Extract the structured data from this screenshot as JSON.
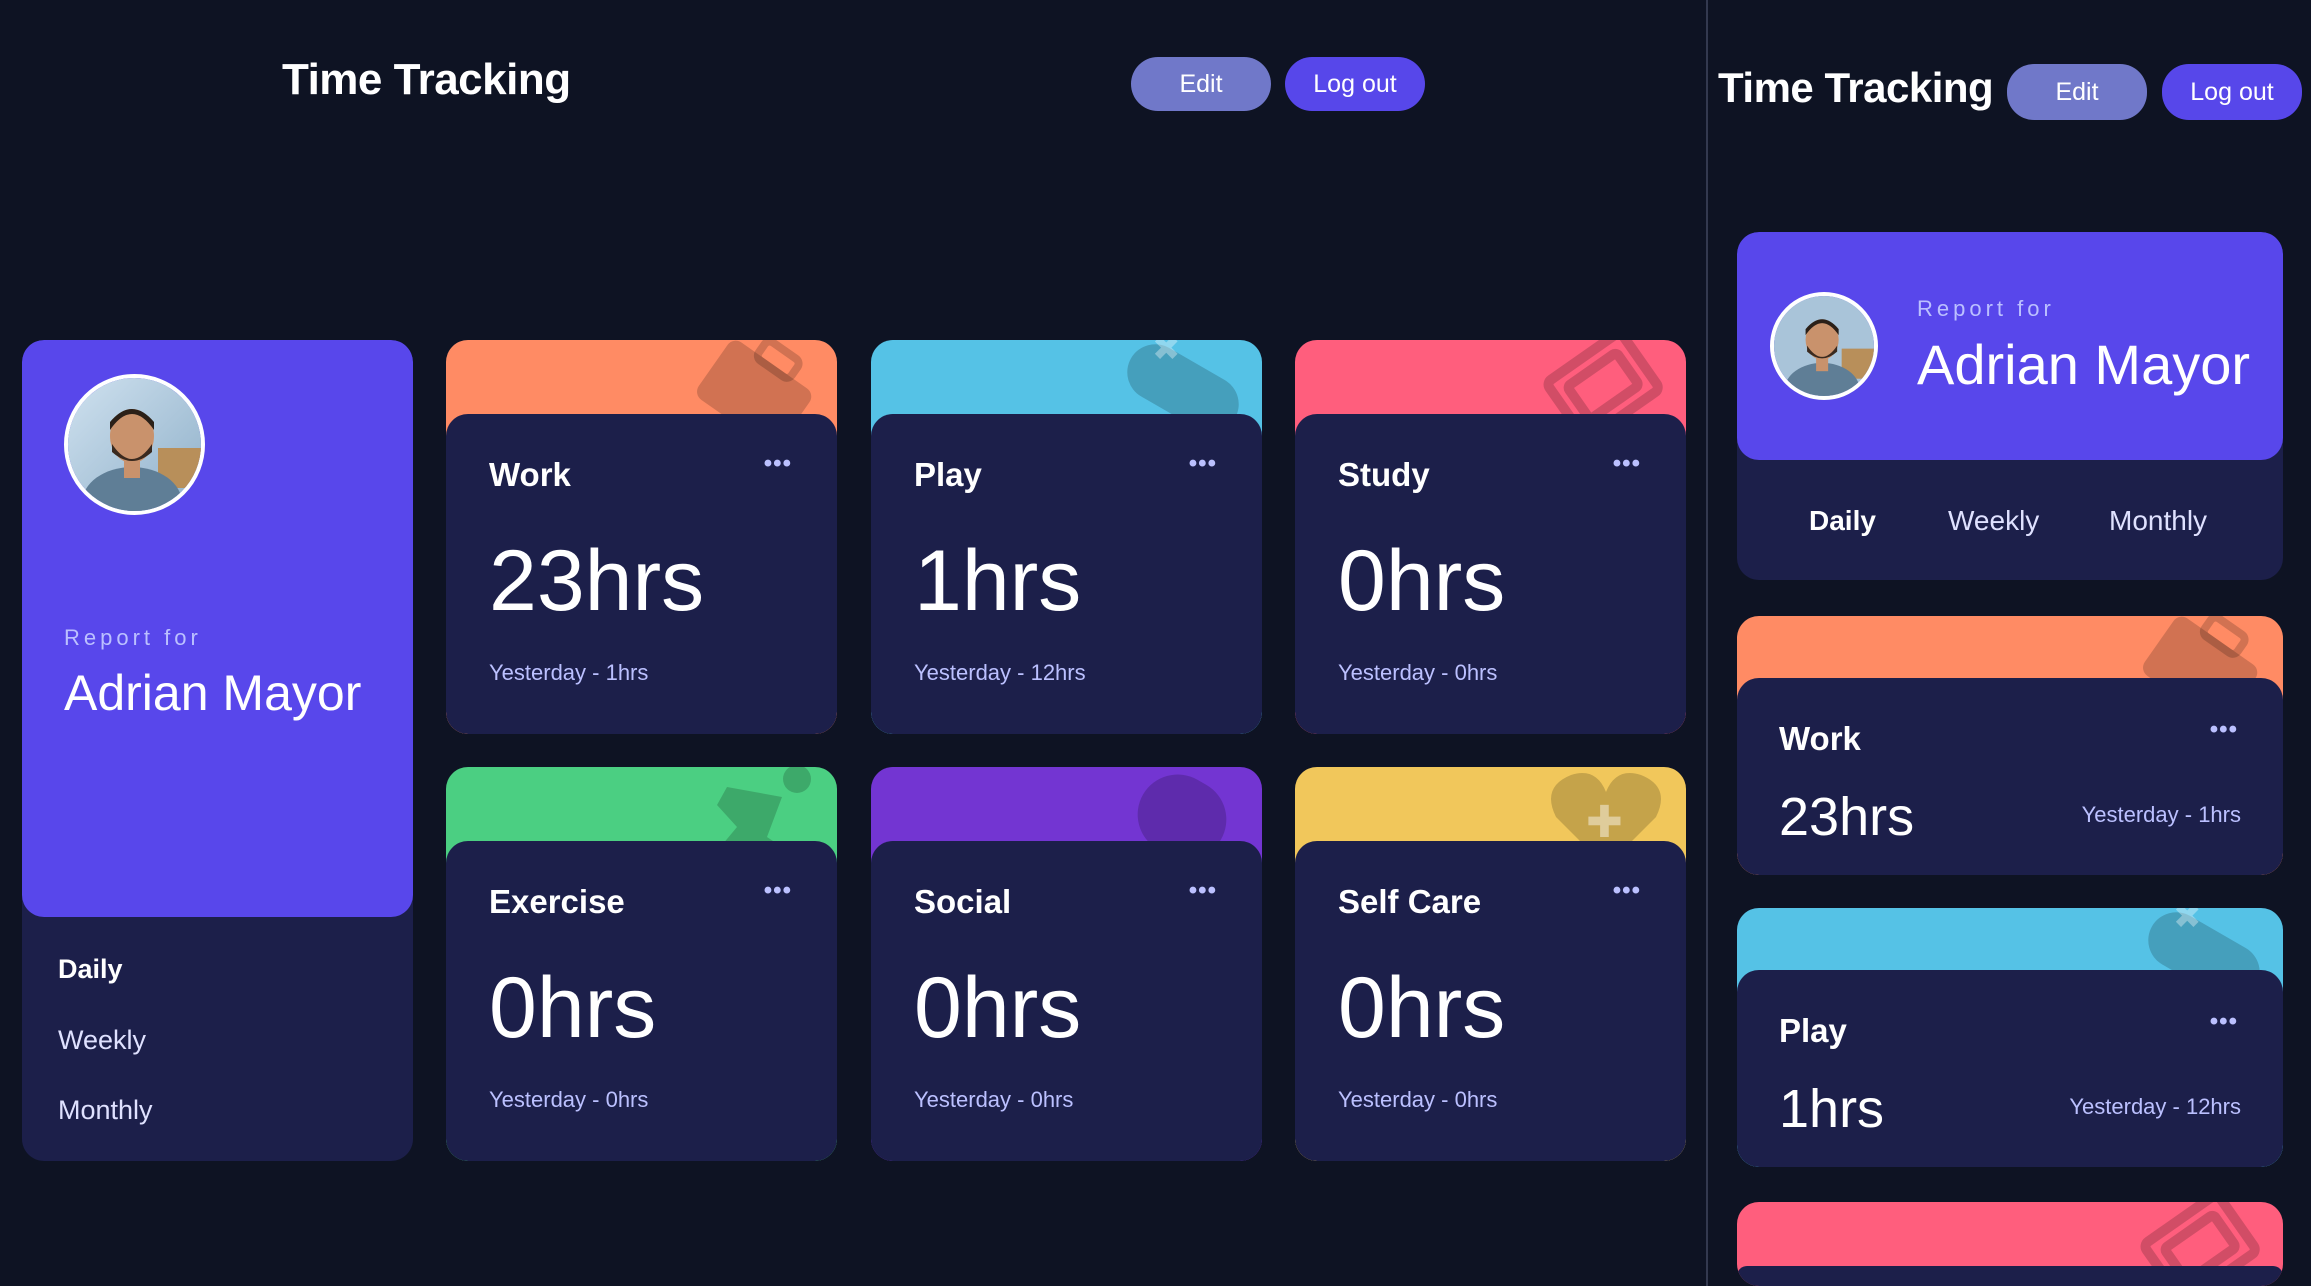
{
  "app": {
    "title": "Time Tracking"
  },
  "buttons": {
    "edit": "Edit",
    "logout": "Log out"
  },
  "colors": {
    "background": "#0e1323",
    "card": "#1c1f4a",
    "profile": "#5847eb",
    "edit": "#7078c9",
    "logout": "#5747ea",
    "work": "#ff8b64",
    "play": "#55c2e6",
    "study": "#ff5e7d",
    "exercise": "#4bcf82",
    "social": "#7335d2",
    "selfcare": "#f1c75b"
  },
  "profile": {
    "report_for": "Report for",
    "name": "Adrian Mayor",
    "periods": [
      "Daily",
      "Weekly",
      "Monthly"
    ],
    "active_period": "Daily"
  },
  "cards": [
    {
      "title": "Work",
      "hours": "23hrs",
      "previous": "Yesterday - 1hrs",
      "icon": "briefcase-icon",
      "color": "#ff8b64"
    },
    {
      "title": "Play",
      "hours": "1hrs",
      "previous": "Yesterday - 12hrs",
      "icon": "gamepad-icon",
      "color": "#55c2e6"
    },
    {
      "title": "Study",
      "hours": "0hrs",
      "previous": "Yesterday - 0hrs",
      "icon": "book-icon",
      "color": "#ff5e7d"
    },
    {
      "title": "Exercise",
      "hours": "0hrs",
      "previous": "Yesterday - 0hrs",
      "icon": "running-icon",
      "color": "#4bcf82"
    },
    {
      "title": "Social",
      "hours": "0hrs",
      "previous": "Yesterday - 0hrs",
      "icon": "social-icon",
      "color": "#7335d2"
    },
    {
      "title": "Self Care",
      "hours": "0hrs",
      "previous": "Yesterday - 0hrs",
      "icon": "heart-icon",
      "color": "#f1c75b"
    }
  ],
  "menu_glyph": "•••"
}
